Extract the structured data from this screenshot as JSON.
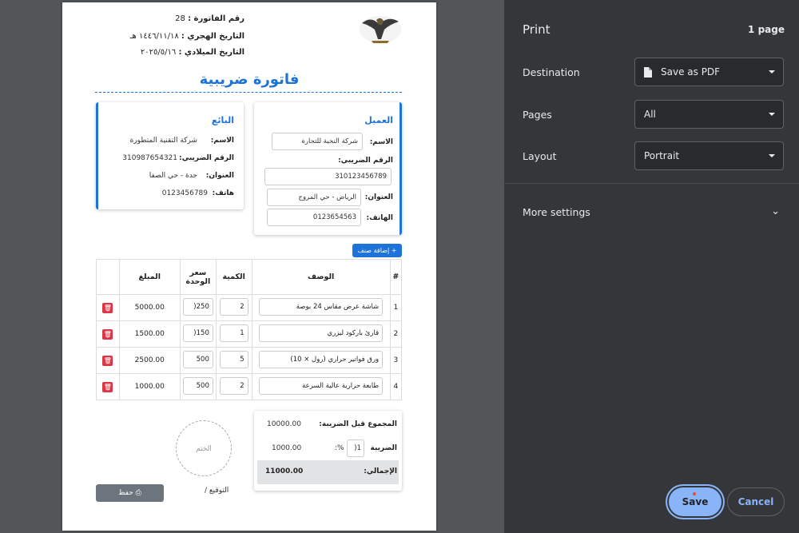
{
  "invoice": {
    "number_label": "رقم الفاتورة :",
    "number_value": "28",
    "hijri_label": "التاريخ الهجري :",
    "hijri_value": "١٤٤٦/١١/١٨ هـ",
    "gregorian_label": "التاريخ الميلادي :",
    "gregorian_value": "٢٠٢٥/٥/١٦",
    "title": "فاتورة ضريبية",
    "client": {
      "heading": "العميل",
      "name_label": "الاسم:",
      "name_value": "شركة النخبة للتجارة",
      "tax_label": "الرقم الضريبي:",
      "tax_value": "310123456789",
      "address_label": "العنوان:",
      "address_value": "الرياض - حي المروج",
      "phone_label": "الهاتف:",
      "phone_value": "0123654563"
    },
    "seller": {
      "heading": "البائع",
      "name_label": "الاسم:",
      "name_value": "شركة التقنية المتطورة",
      "tax_label": "الرقم الضريبي:",
      "tax_value": "310987654321",
      "address_label": "العنوان:",
      "address_value": "جدة - حي الصفا",
      "phone_label": "هاتف:",
      "phone_value": "0123456789"
    },
    "add_item_label": "+ إضافة صنف",
    "table": {
      "headers": [
        "#",
        "الوصف",
        "الكمية",
        "سعر الوحدة",
        "المبلغ",
        ""
      ],
      "rows": [
        {
          "num": "1",
          "desc": "شاشة عرض مقاس 24 بوصة",
          "qty": "2",
          "price": "250(",
          "amount": "5000.00"
        },
        {
          "num": "2",
          "desc": "قارئ باركود ليزري",
          "qty": "1",
          "price": "150(",
          "amount": "1500.00"
        },
        {
          "num": "3",
          "desc": "ورق فواتير حراري (رول × 10)",
          "qty": "5",
          "price": "500",
          "amount": "2500.00"
        },
        {
          "num": "4",
          "desc": "طابعة حرارية عالية السرعة",
          "qty": "2",
          "price": "500",
          "amount": "1000.00"
        }
      ]
    },
    "totals": {
      "subtotal_label": "المجموع قبل الضريبة:",
      "subtotal_value": "10000.00",
      "tax_label": "الضريبة",
      "tax_rate": "1(",
      "tax_percent": "%:",
      "tax_value": "1000.00",
      "total_label": "الإجمالي:",
      "total_value": "11000.00"
    },
    "stamp_label": "الختم",
    "signature_label": "التوقيع /",
    "save_label": "حفظ"
  },
  "print_panel": {
    "title": "Print",
    "page_count": "1 page",
    "destination_label": "Destination",
    "destination_value": "Save as PDF",
    "pages_label": "Pages",
    "pages_value": "All",
    "layout_label": "Layout",
    "layout_value": "Portrait",
    "more_settings": "More settings",
    "save_button": "Save",
    "cancel_button": "Cancel"
  },
  "icons": [
    "logo-eagle",
    "document-icon",
    "chevron-down-icon",
    "trash-icon",
    "save-icon"
  ],
  "colors": {
    "accent": "#1e73d8",
    "delete": "#dc3545",
    "panel_bg": "#35363a",
    "save_button": "#8ab4f8"
  }
}
